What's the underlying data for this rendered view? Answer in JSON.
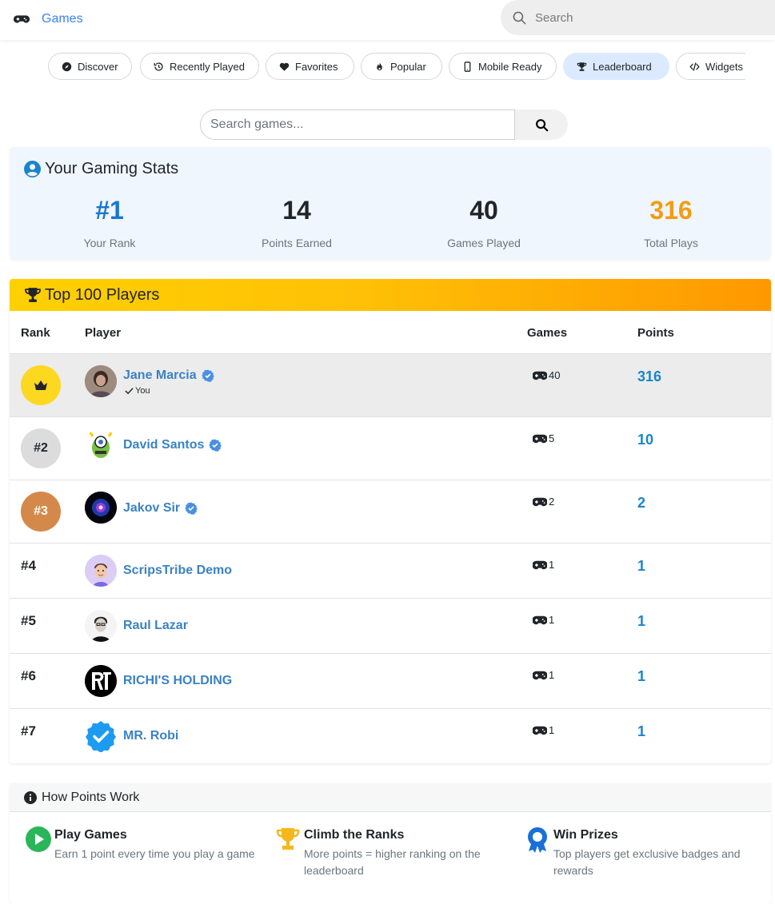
{
  "header": {
    "brand_label": "Games",
    "search_placeholder": "Search"
  },
  "nav": {
    "pills": [
      {
        "label": "Discover",
        "icon": "compass-icon"
      },
      {
        "label": "Recently Played",
        "icon": "history-icon"
      },
      {
        "label": "Favorites",
        "icon": "heart-icon"
      },
      {
        "label": "Popular",
        "icon": "fire-icon"
      },
      {
        "label": "Mobile Ready",
        "icon": "mobile-icon"
      },
      {
        "label": "Leaderboard",
        "icon": "trophy-icon",
        "active": true
      },
      {
        "label": "Widgets",
        "icon": "code-icon"
      }
    ]
  },
  "game_search": {
    "placeholder": "Search games..."
  },
  "stats": {
    "title": "Your Gaming Stats",
    "items": [
      {
        "value": "#1",
        "label": "Your Rank",
        "color": "#1976d2"
      },
      {
        "value": "14",
        "label": "Points Earned",
        "color": "#212529"
      },
      {
        "value": "40",
        "label": "Games Played",
        "color": "#212529"
      },
      {
        "value": "316",
        "label": "Total Plays",
        "color": "#f39c12"
      }
    ]
  },
  "leaderboard": {
    "title": "Top 100 Players",
    "columns": {
      "rank": "Rank",
      "player": "Player",
      "games": "Games",
      "points": "Points"
    },
    "you_label": "You",
    "rows": [
      {
        "rank": "",
        "badge": "crown",
        "name": "Jane Marcia",
        "verified": true,
        "you": true,
        "games": "40",
        "points": "316"
      },
      {
        "rank": "#2",
        "badge": "silver",
        "name": "David Santos",
        "verified": true,
        "games": "5",
        "points": "10"
      },
      {
        "rank": "#3",
        "badge": "bronze",
        "name": "Jakov Sir",
        "verified": true,
        "games": "2",
        "points": "2"
      },
      {
        "rank": "#4",
        "name": "ScripsTribe Demo",
        "games": "1",
        "points": "1"
      },
      {
        "rank": "#5",
        "name": "Raul Lazar",
        "games": "1",
        "points": "1"
      },
      {
        "rank": "#6",
        "name": "RICHI'S HOLDING",
        "games": "1",
        "points": "1"
      },
      {
        "rank": "#7",
        "name": "MR. Robi",
        "games": "1",
        "points": "1"
      }
    ]
  },
  "how_points": {
    "title": "How Points Work",
    "items": [
      {
        "title": "Play Games",
        "desc": "Earn 1 point every time you play a game",
        "icon": "play-circle-icon"
      },
      {
        "title": "Climb the Ranks",
        "desc": "More points = higher ranking on the leaderboard",
        "icon": "trophy-icon"
      },
      {
        "title": "Win Prizes",
        "desc": "Top players get exclusive badges and rewards",
        "icon": "award-icon"
      }
    ]
  }
}
